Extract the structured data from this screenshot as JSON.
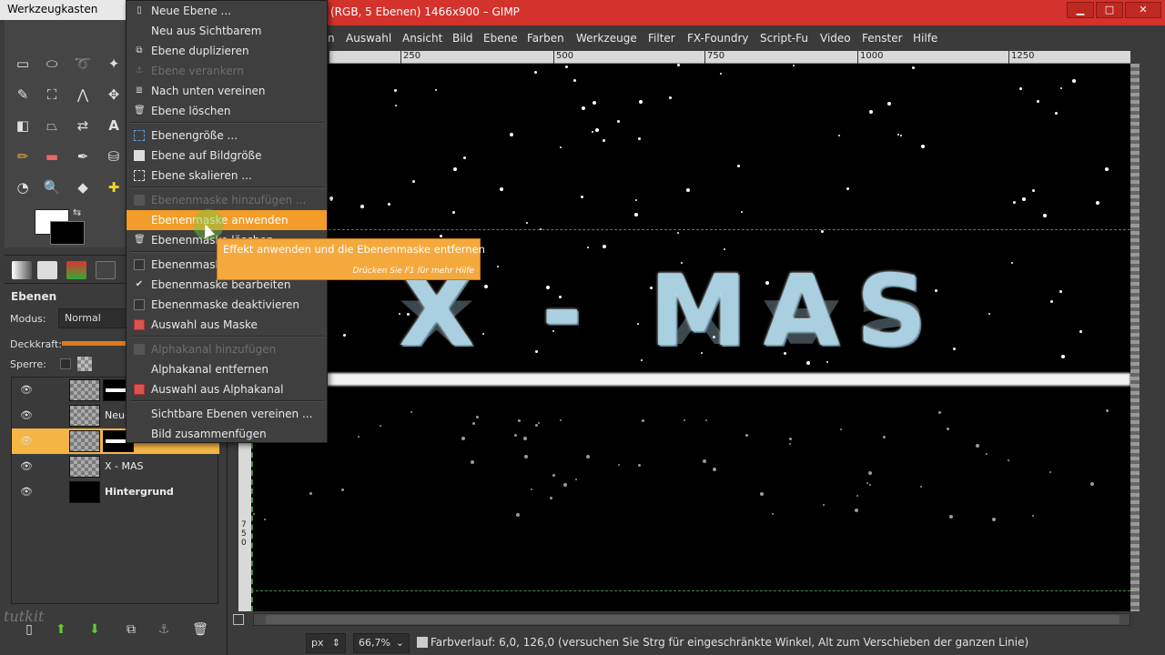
{
  "toolbox": {
    "title": "Werkzeugkasten",
    "layers_title": "Ebenen",
    "mode_label": "Modus:",
    "mode_value": "Normal",
    "opacity_label": "Deckkraft:",
    "lock_label": "Sperre:",
    "watermark": "tutkit",
    "layers": [
      {
        "name": "",
        "selected": false
      },
      {
        "name": "Neue",
        "selected": false
      },
      {
        "name": "",
        "selected": true
      },
      {
        "name": "X - MAS",
        "selected": false
      },
      {
        "name": "Hintergrund",
        "selected": false
      }
    ]
  },
  "window": {
    "title": "(RGB, 5 Ebenen) 1466x900 – GIMP",
    "minimize": "▁",
    "maximize": "□",
    "close": "✕"
  },
  "menubar": [
    "n",
    "Auswahl",
    "Ansicht",
    "Bild",
    "Ebene",
    "Farben",
    "Werkzeuge",
    "Filter",
    "FX-Foundry",
    "Script-Fu",
    "Video",
    "Fenster",
    "Hilfe"
  ],
  "ruler": {
    "top": [
      "250",
      "500",
      "750",
      "1000",
      "1250"
    ],
    "left": [
      "7",
      "5",
      "0"
    ]
  },
  "canvas": {
    "text": "X - MAS"
  },
  "context_menu": [
    {
      "label": "Neue Ebene ...",
      "icon": "new-layer-icon",
      "disabled": false
    },
    {
      "label": "Neu aus Sichtbarem",
      "icon": "",
      "disabled": false
    },
    {
      "label": "Ebene duplizieren",
      "icon": "duplicate-icon",
      "disabled": false
    },
    {
      "label": "Ebene verankern",
      "icon": "anchor-icon",
      "disabled": true
    },
    {
      "label": "Nach unten vereinen",
      "icon": "merge-down-icon",
      "disabled": false
    },
    {
      "label": "Ebene löschen",
      "icon": "trash-icon",
      "disabled": false
    },
    {
      "label": "Ebenengröße ...",
      "icon": "layer-size-icon",
      "disabled": false
    },
    {
      "label": "Ebene auf Bildgröße",
      "icon": "fit-image-icon",
      "disabled": false
    },
    {
      "label": "Ebene skalieren ...",
      "icon": "scale-icon",
      "disabled": false
    },
    {
      "label": "Ebenenmaske hinzufügen ...",
      "icon": "add-mask-icon",
      "disabled": true
    },
    {
      "label": "Ebenenmaske anwenden",
      "icon": "",
      "disabled": false
    },
    {
      "label": "Ebenenmaske löschen",
      "icon": "delete-mask-icon",
      "disabled": false
    },
    {
      "label": "Ebenenmaske anzeigen",
      "icon": "checkbox-icon",
      "disabled": false
    },
    {
      "label": "Ebenenmaske bearbeiten",
      "icon": "check-icon",
      "disabled": false
    },
    {
      "label": "Ebenenmaske deaktivieren",
      "icon": "checkbox-icon",
      "disabled": false
    },
    {
      "label": "Auswahl aus Maske",
      "icon": "selection-icon",
      "disabled": false
    },
    {
      "label": "Alphakanal hinzufügen",
      "icon": "alpha-icon",
      "disabled": true
    },
    {
      "label": "Alphakanal entfernen",
      "icon": "",
      "disabled": false
    },
    {
      "label": "Auswahl aus Alphakanal",
      "icon": "selection-icon",
      "disabled": false
    },
    {
      "label": "Sichtbare Ebenen vereinen ...",
      "icon": "",
      "disabled": false
    },
    {
      "label": "Bild zusammenfügen",
      "icon": "",
      "disabled": false
    }
  ],
  "tooltip": {
    "main": "Effekt anwenden und die Ebenenmaske entfernen",
    "hint": "Drücken Sie F1 für mehr Hilfe"
  },
  "statusbar": {
    "unit": "px",
    "zoom": "66,7%",
    "text": "Farbverlauf: 6,0, 126,0 (versuchen Sie Strg für eingeschränkte Winkel, Alt zum Verschieben der ganzen Linie)"
  }
}
